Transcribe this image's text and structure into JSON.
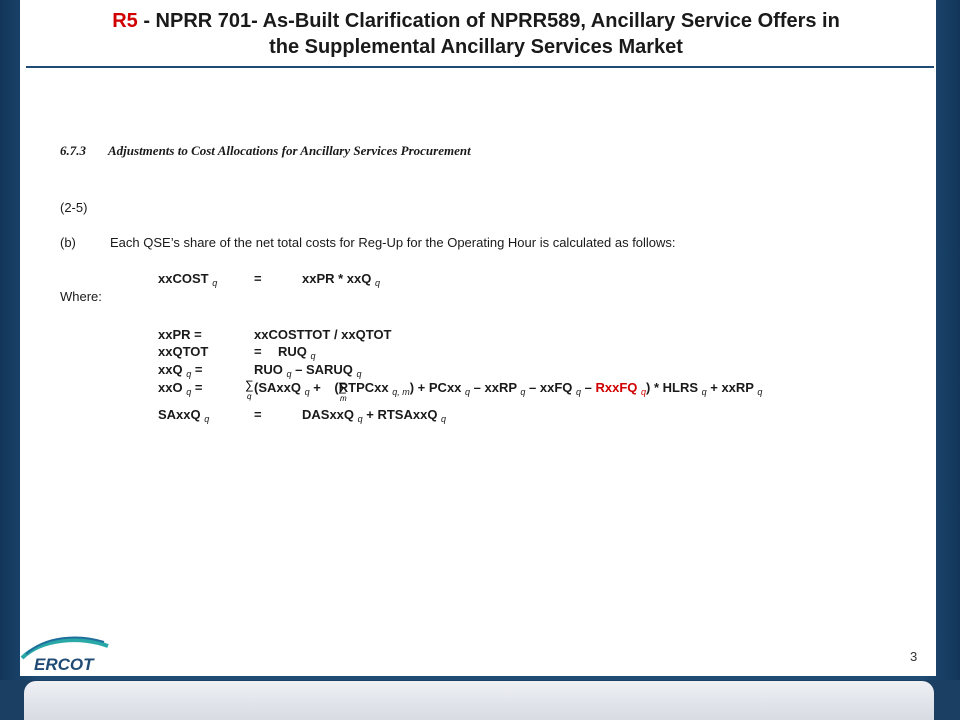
{
  "title": {
    "tag": "R5",
    "text_line1": " - NPRR 701- As-Built Clarification of NPRR589, Ancillary Service Offers in",
    "text_line2": "the Supplemental Ancillary Services Market"
  },
  "section": {
    "number": "6.7.3",
    "heading": "Adjustments to Cost Allocations for Ancillary Services Procurement"
  },
  "para_ref": "(2-5)",
  "para_b": {
    "label": "(b)",
    "text": "Each QSE’s share of the net total costs for Reg-Up for the Operating Hour is calculated as follows:"
  },
  "where": "Where:",
  "logo_text": "ERCOT",
  "page_number": "3",
  "colors": {
    "accent": "#d00000",
    "navy": "#1f4b74"
  }
}
